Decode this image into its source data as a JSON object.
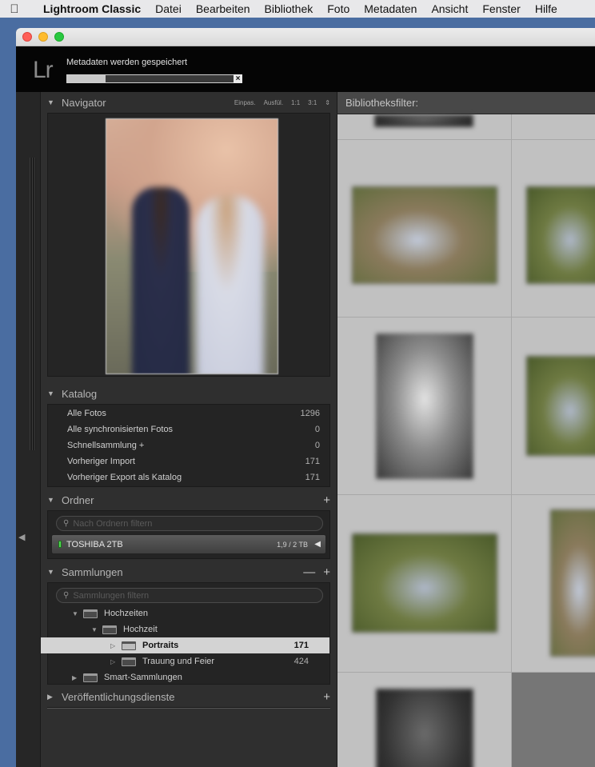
{
  "menubar": {
    "app_name": "Lightroom Classic",
    "items": [
      "Datei",
      "Bearbeiten",
      "Bibliothek",
      "Foto",
      "Metadaten",
      "Ansicht",
      "Fenster",
      "Hilfe"
    ]
  },
  "identity": {
    "logo": "Lr",
    "status": "Metadaten werden gespeichert",
    "progress_fraction": 0.22,
    "close": "×"
  },
  "navigator": {
    "title": "Navigator",
    "zoom_options": [
      "Einpas.",
      "Ausfül.",
      "1:1",
      "3:1"
    ]
  },
  "catalog": {
    "title": "Katalog",
    "rows": [
      {
        "label": "Alle Fotos",
        "count": "1296"
      },
      {
        "label": "Alle synchronisierten Fotos",
        "count": "0"
      },
      {
        "label": "Schnellsammlung +",
        "count": "0"
      },
      {
        "label": "Vorheriger Import",
        "count": "171"
      },
      {
        "label": "Vorheriger Export als Katalog",
        "count": "171"
      }
    ]
  },
  "folders": {
    "title": "Ordner",
    "search_placeholder": "Nach Ordnern filtern",
    "volume": {
      "name": "TOSHIBA 2TB",
      "size": "1,9 / 2 TB"
    }
  },
  "collections": {
    "title": "Sammlungen",
    "search_placeholder": "Sammlungen filtern",
    "rows": [
      {
        "label": "Hochzeiten",
        "count": ""
      },
      {
        "label": "Hochzeit",
        "count": ""
      },
      {
        "label": "Portraits",
        "count": "171"
      },
      {
        "label": "Trauung und Feier",
        "count": "424"
      },
      {
        "label": "Smart-Sammlungen",
        "count": ""
      }
    ]
  },
  "publish": {
    "title": "Veröffentlichungsdienste"
  },
  "grid": {
    "filter_label": "Bibliotheksfilter:"
  },
  "colors": {
    "panel_bg": "#2f2f2f",
    "selected_row": "#d3d3d3",
    "grid_bg": "#b3b3b3"
  }
}
